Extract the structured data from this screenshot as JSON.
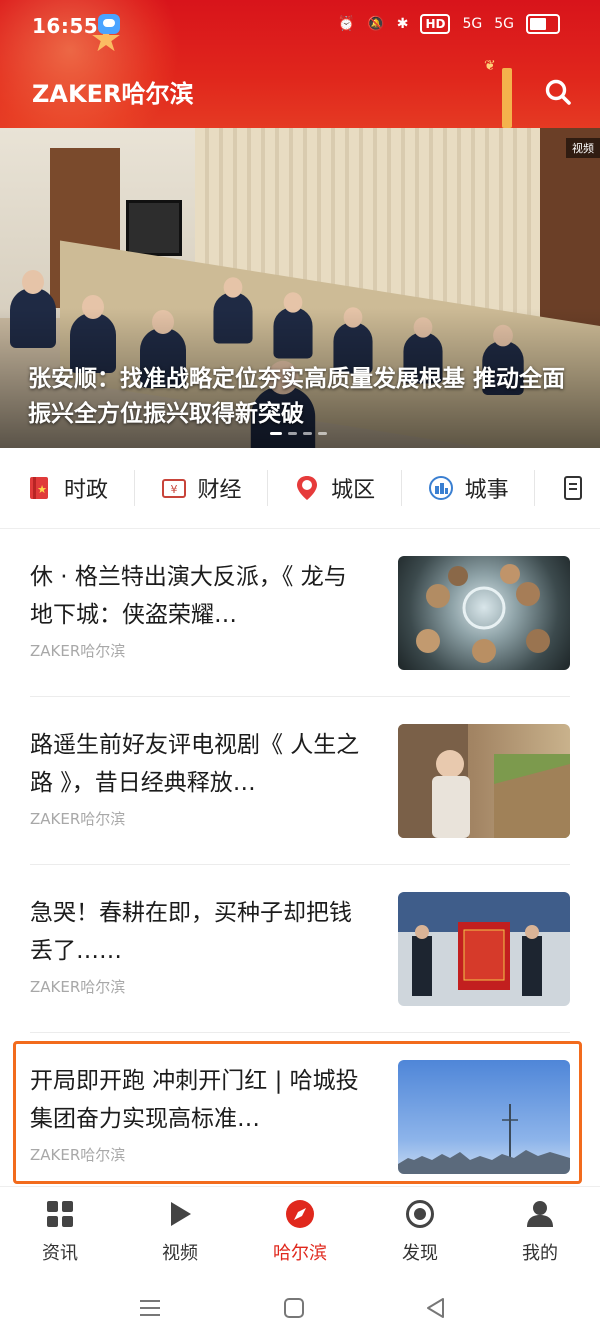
{
  "status_bar": {
    "time": "16:55",
    "hd_badge": "HD",
    "net_1": "5G",
    "net_2": "5G"
  },
  "header": {
    "brand": "ZAKER哈尔滨",
    "accent_color": "#d8141b"
  },
  "hero": {
    "badge": "视频",
    "caption": "张安顺：找准战略定位夯实高质量发展根基 推动全面振兴全方位振兴取得新突破"
  },
  "categories": [
    {
      "label": "时政",
      "icon": "politics-icon"
    },
    {
      "label": "财经",
      "icon": "finance-icon"
    },
    {
      "label": "城区",
      "icon": "district-icon"
    },
    {
      "label": "城事",
      "icon": "city-events-icon"
    }
  ],
  "news": [
    {
      "title": "休 · 格兰特出演大反派，《 龙与地下城：侠盗荣耀…",
      "source": "ZAKER哈尔滨"
    },
    {
      "title": "路遥生前好友评电视剧《 人生之路 》，昔日经典释放…",
      "source": "ZAKER哈尔滨"
    },
    {
      "title": "急哭！春耕在即，买种子却把钱丢了……",
      "source": "ZAKER哈尔滨"
    },
    {
      "title": "开局即开跑 冲刺开门红 | 哈城投集团奋力实现高标准…",
      "source": "ZAKER哈尔滨"
    }
  ],
  "bottom_nav": [
    {
      "label": "资讯",
      "icon": "grid-icon"
    },
    {
      "label": "视频",
      "icon": "play-icon"
    },
    {
      "label": "哈尔滨",
      "icon": "compass-icon",
      "active": true
    },
    {
      "label": "发现",
      "icon": "discover-icon"
    },
    {
      "label": "我的",
      "icon": "profile-icon"
    }
  ]
}
